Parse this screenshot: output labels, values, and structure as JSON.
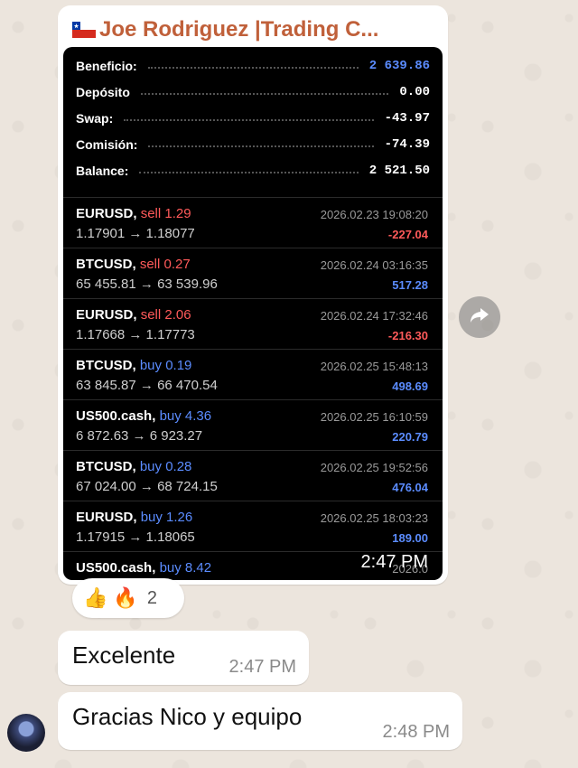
{
  "main_message": {
    "sender": "Joe Rodriguez |Trading C...",
    "time": "2:47 PM",
    "summary": [
      {
        "label": "Beneficio:",
        "value": "2 639.86",
        "accent": true
      },
      {
        "label": "Depósito",
        "value": "0.00",
        "accent": false
      },
      {
        "label": "Swap:",
        "value": "-43.97",
        "accent": false
      },
      {
        "label": "Comisión:",
        "value": "-74.39",
        "accent": false
      },
      {
        "label": "Balance:",
        "value": "2 521.50",
        "accent": false
      }
    ],
    "trades": [
      {
        "symbol": "EURUSD,",
        "side": "sell",
        "lot": "1.29",
        "prices": "1.17901 → 1.18077",
        "datetime": "2026.02.23 19:08:20",
        "pl": "-227.04"
      },
      {
        "symbol": "BTCUSD,",
        "side": "sell",
        "lot": "0.27",
        "prices": "65 455.81 → 63 539.96",
        "datetime": "2026.02.24 03:16:35",
        "pl": "517.28"
      },
      {
        "symbol": "EURUSD,",
        "side": "sell",
        "lot": "2.06",
        "prices": "1.17668 → 1.17773",
        "datetime": "2026.02.24 17:32:46",
        "pl": "-216.30"
      },
      {
        "symbol": "BTCUSD,",
        "side": "buy",
        "lot": "0.19",
        "prices": "63 845.87 → 66 470.54",
        "datetime": "2026.02.25 15:48:13",
        "pl": "498.69"
      },
      {
        "symbol": "US500.cash,",
        "side": "buy",
        "lot": "4.36",
        "prices": "6 872.63 → 6 923.27",
        "datetime": "2026.02.25 16:10:59",
        "pl": "220.79"
      },
      {
        "symbol": "BTCUSD,",
        "side": "buy",
        "lot": "0.28",
        "prices": "67 024.00 → 68 724.15",
        "datetime": "2026.02.25 19:52:56",
        "pl": "476.04"
      },
      {
        "symbol": "EURUSD,",
        "side": "buy",
        "lot": "1.26",
        "prices": "1.17915 → 1.18065",
        "datetime": "2026.02.25 18:03:23",
        "pl": "189.00"
      },
      {
        "symbol": "US500.cash,",
        "side": "buy",
        "lot": "8.42",
        "prices": "",
        "datetime": "2026.0",
        "pl": ""
      }
    ]
  },
  "reactions": {
    "emojis": [
      "👍",
      "🔥"
    ],
    "count": "2"
  },
  "messages": [
    {
      "text": "Excelente",
      "time": "2:47 PM"
    },
    {
      "text": "Gracias Nico y equipo",
      "time": "2:48 PM"
    }
  ],
  "colors": {
    "sell": "#ff5a5a",
    "buy": "#5b8cff",
    "sender": "#c0603a"
  },
  "icons": {
    "forward": "forward-arrow-icon",
    "flag": "chile-flag-icon",
    "avatar": "user-avatar"
  }
}
